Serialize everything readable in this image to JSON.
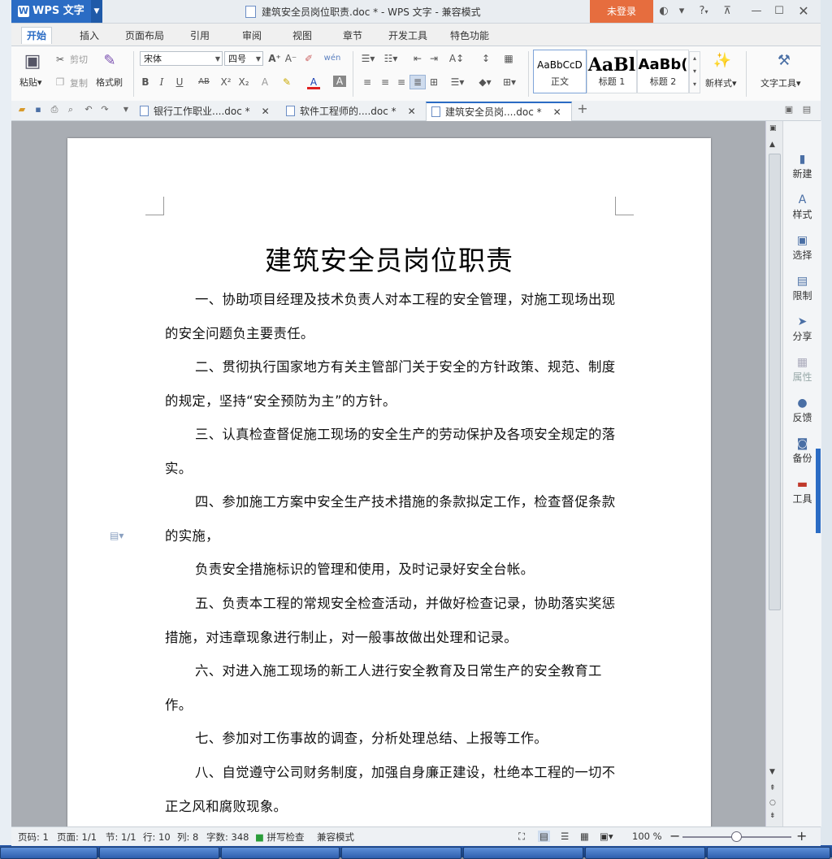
{
  "app": {
    "name": "WPS 文字",
    "logo_letter": "W"
  },
  "window": {
    "title": "建筑安全员岗位职责.doc * - WPS 文字 - 兼容模式",
    "login_label": "未登录",
    "help_label": "?"
  },
  "menu": {
    "tabs": [
      "开始",
      "插入",
      "页面布局",
      "引用",
      "审阅",
      "视图",
      "章节",
      "开发工具",
      "特色功能"
    ],
    "active": "开始"
  },
  "ribbon": {
    "paste": "粘贴",
    "cut": "剪切",
    "copy": "复制",
    "format_painter": "格式刷",
    "font_name": "宋体",
    "font_size": "四号",
    "styles": [
      {
        "sample": "AaBbCcD",
        "caption": "正文"
      },
      {
        "sample": "AaBl",
        "caption": "标题 1"
      },
      {
        "sample": "AaBb(",
        "caption": "标题 2"
      }
    ],
    "new_style": "新样式",
    "text_tools": "文字工具"
  },
  "doc_tabs": [
    {
      "label": "银行工作职业....doc *",
      "active": false
    },
    {
      "label": "软件工程师的....doc *",
      "active": false
    },
    {
      "label": "建筑安全员岗....doc *",
      "active": true
    }
  ],
  "document": {
    "heading": "建筑安全员岗位职责",
    "paragraphs": [
      "一、协助项目经理及技术负责人对本工程的安全管理，对施工现场出现的安全问题负主要责任。",
      "二、贯彻执行国家地方有关主管部门关于安全的方针政策、规范、制度的规定，坚持“安全预防为主”的方针。",
      "三、认真检查督促施工现场的安全生产的劳动保护及各项安全规定的落实。",
      "四、参加施工方案中安全生产技术措施的条款拟定工作，检查督促条款的实施，",
      "负责安全措施标识的管理和使用，及时记录好安全台帐。",
      "五、负责本工程的常规安全检查活动，并做好检查记录，协助落实奖惩措施，对违章现象进行制止，对一般事故做出处理和记录。",
      "六、对进入施工现场的新工人进行安全教育及日常生产的安全教育工作。",
      "七、参加对工伤事故的调查，分析处理总结、上报等工作。",
      "八、自觉遵守公司财务制度，加强自身廉正建设，杜绝本工程的一切不正之风和腐败现象。"
    ]
  },
  "side_panel": {
    "items": [
      {
        "label": "新建",
        "icon": "new-doc-icon",
        "glyph": "▮",
        "dim": false
      },
      {
        "label": "样式",
        "icon": "style-icon",
        "glyph": "A",
        "dim": false
      },
      {
        "label": "选择",
        "icon": "select-icon",
        "glyph": "▣",
        "dim": false
      },
      {
        "label": "限制",
        "icon": "lock-icon",
        "glyph": "▤",
        "dim": false
      },
      {
        "label": "分享",
        "icon": "share-icon",
        "glyph": "➤",
        "dim": false
      },
      {
        "label": "属性",
        "icon": "properties-icon",
        "glyph": "▦",
        "dim": true
      },
      {
        "label": "反馈",
        "icon": "feedback-icon",
        "glyph": "●",
        "dim": false
      },
      {
        "label": "备份",
        "icon": "backup-icon",
        "glyph": "◙",
        "dim": false
      },
      {
        "label": "工具",
        "icon": "toolbox-icon",
        "glyph": "▬",
        "dim": false
      }
    ]
  },
  "status": {
    "page_num": "页码: 1",
    "pages": "页面: 1/1",
    "section": "节: 1/1",
    "row": "行: 10",
    "col": "列: 8",
    "words": "字数: 348",
    "spellcheck": "拼写检查",
    "mode": "兼容模式",
    "zoom": "100 %"
  },
  "colors": {
    "accent": "#2b6cc4",
    "login": "#e66d3e"
  }
}
